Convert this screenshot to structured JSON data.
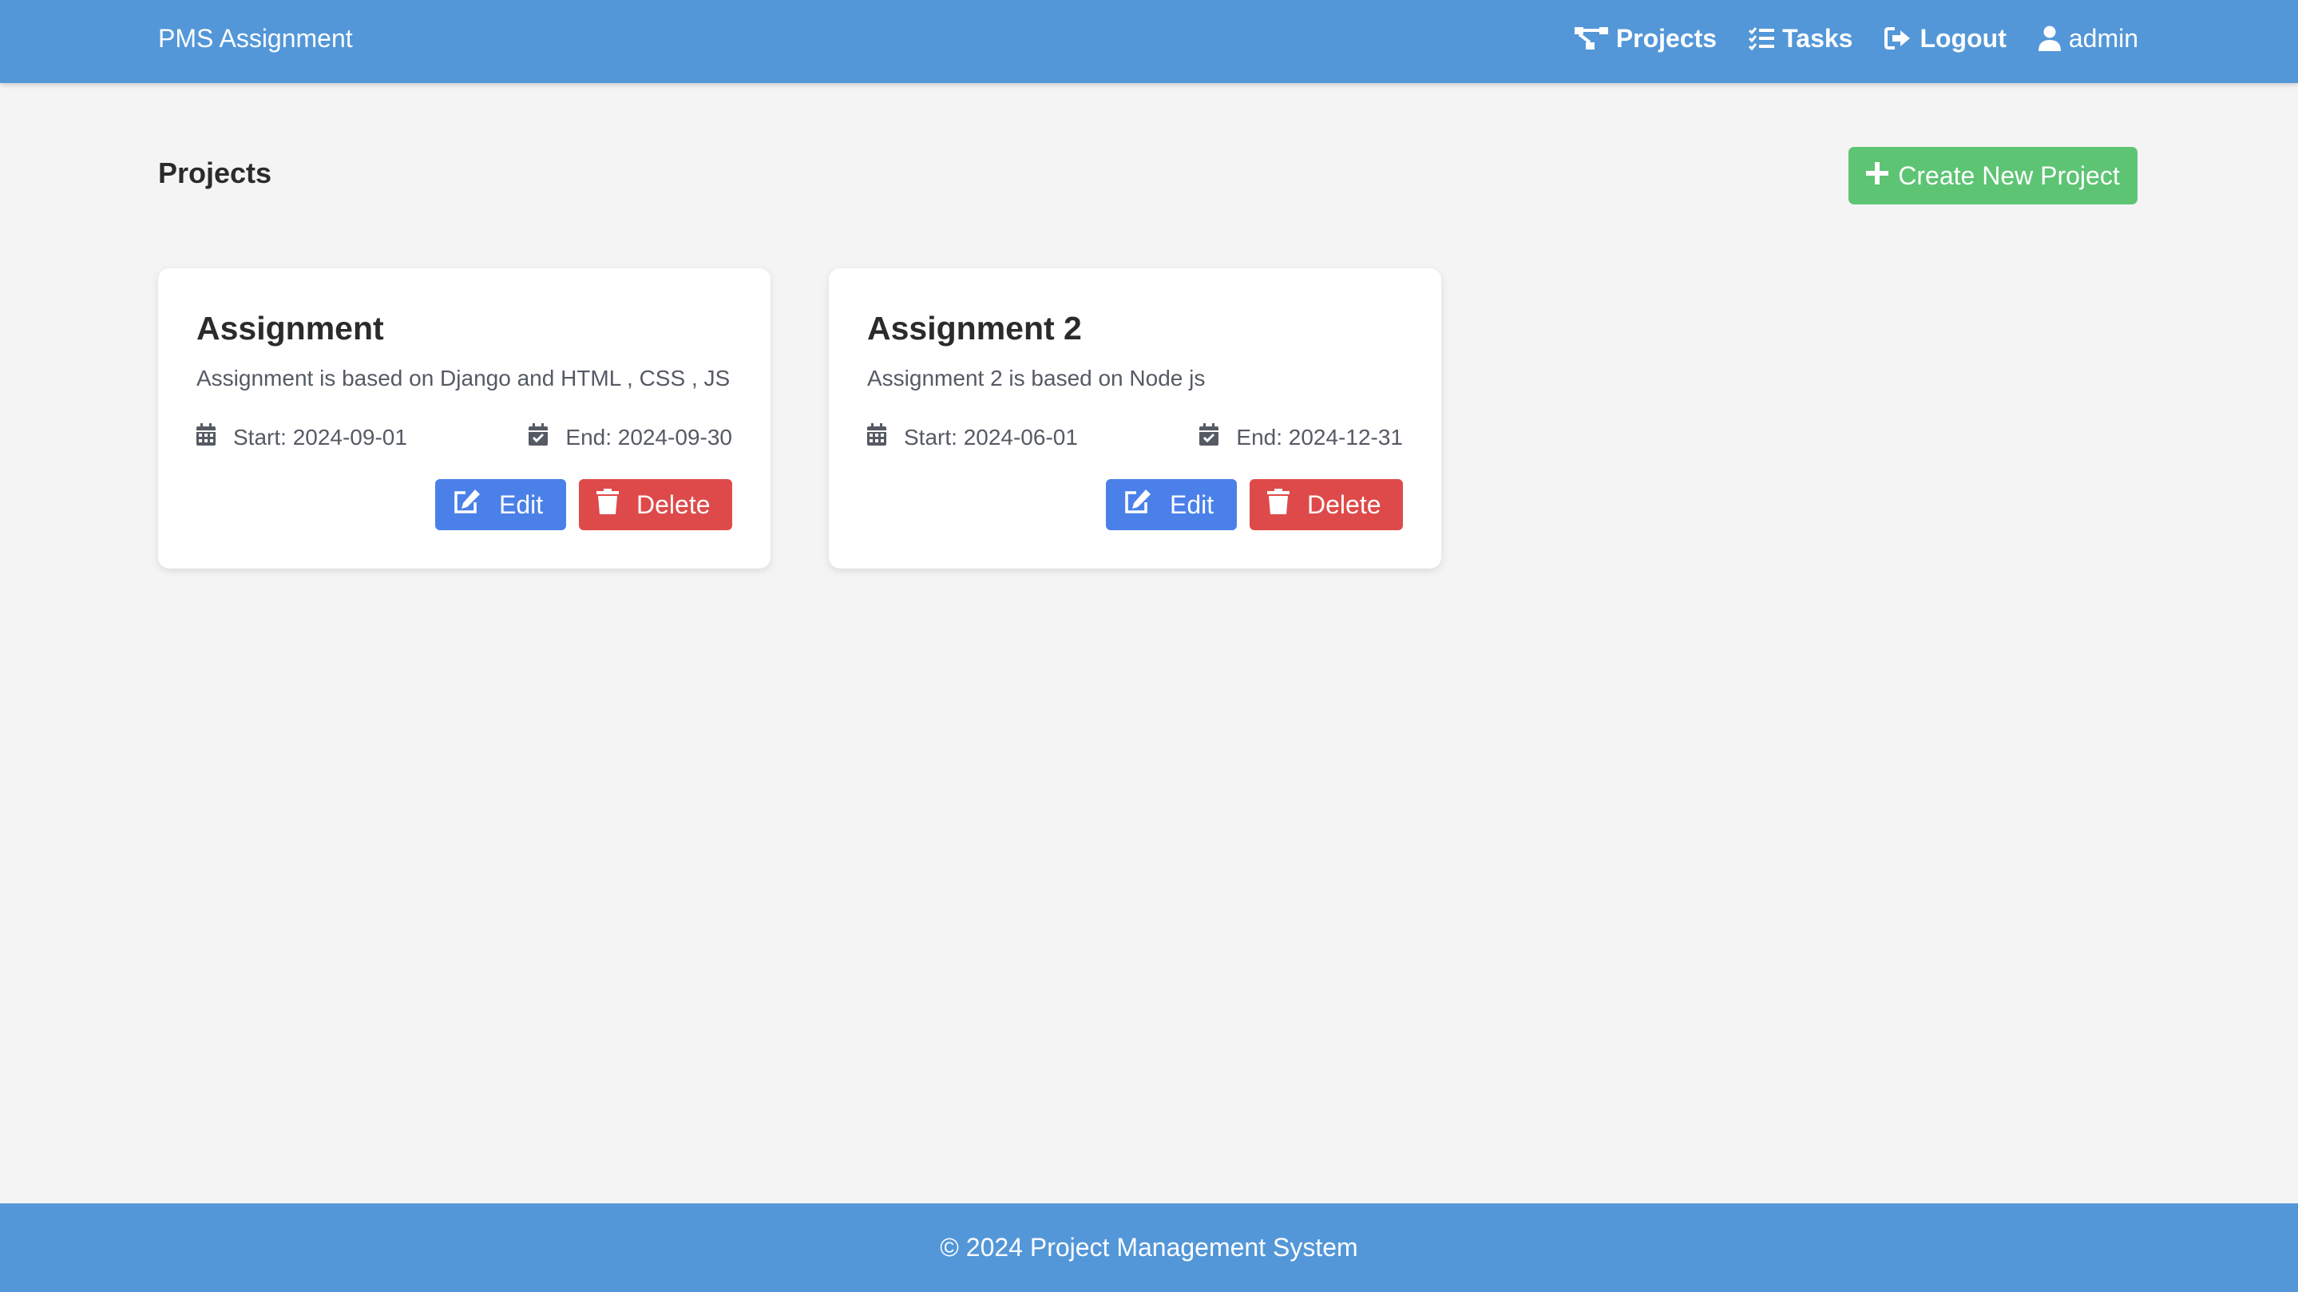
{
  "nav": {
    "brand": "PMS Assignment",
    "links": [
      {
        "label": "Projects",
        "icon": "sitemap-icon"
      },
      {
        "label": "Tasks",
        "icon": "tasks-list-icon"
      },
      {
        "label": "Logout",
        "icon": "logout-icon"
      },
      {
        "label": "admin",
        "icon": "user-icon"
      }
    ]
  },
  "main": {
    "title": "Projects",
    "create_label": "Create New Project"
  },
  "projects": [
    {
      "title": "Assignment",
      "description": "Assignment is based on Django and HTML , CSS , JS",
      "start": "Start: 2024-09-01",
      "end": "End: 2024-09-30",
      "edit_label": "Edit",
      "delete_label": "Delete"
    },
    {
      "title": "Assignment 2",
      "description": "Assignment 2 is based on Node js",
      "start": "Start: 2024-06-01",
      "end": "End: 2024-12-31",
      "edit_label": "Edit",
      "delete_label": "Delete"
    }
  ],
  "footer": {
    "text": "© 2024 Project Management System"
  },
  "colors": {
    "navbar": "#5397d8",
    "background": "#f4f4f4",
    "create_button": "#5dc474",
    "edit_button": "#4a80e8",
    "delete_button": "#de4a4a"
  }
}
